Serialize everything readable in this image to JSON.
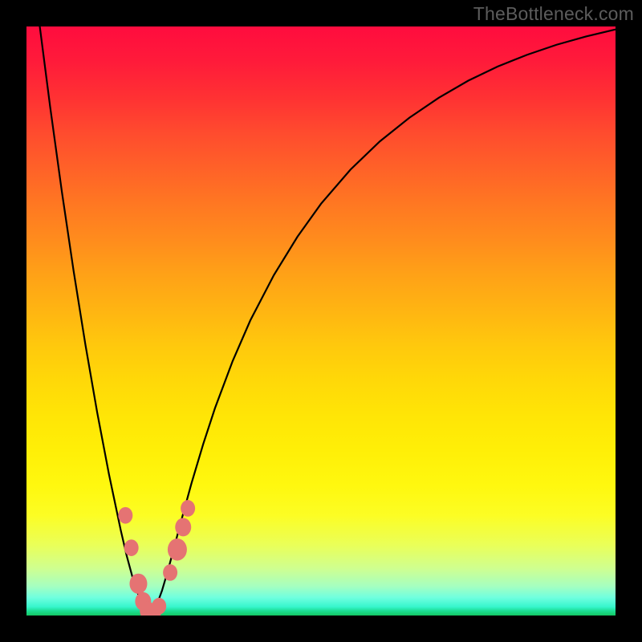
{
  "watermark": "TheBottleneck.com",
  "colors": {
    "curve": "#000000",
    "marker_fill": "#e57373",
    "marker_stroke": "#cc5a5a",
    "gradient_top": "#ff0c3e",
    "gradient_bottom": "#14c864",
    "frame": "#000000"
  },
  "chart_data": {
    "type": "line",
    "title": "",
    "xlabel": "",
    "ylabel": "",
    "xlim": [
      0,
      100
    ],
    "ylim": [
      0,
      100
    ],
    "grid": false,
    "annotations": [],
    "legend": null,
    "curve_minimum_x": 21,
    "series": [
      {
        "name": "bottleneck-curve",
        "x": [
          0,
          2,
          4,
          6,
          8,
          10,
          12,
          14,
          16,
          17,
          18,
          19,
          20,
          20.5,
          21,
          21.5,
          22,
          23,
          24,
          25,
          26,
          28,
          30,
          32,
          35,
          38,
          42,
          46,
          50,
          55,
          60,
          65,
          70,
          75,
          80,
          85,
          90,
          95,
          100
        ],
        "y": [
          120,
          102,
          86.5,
          72,
          58.5,
          46,
          34.5,
          24,
          14.5,
          10.2,
          6.5,
          3.5,
          1.4,
          0.4,
          0,
          0.4,
          1.5,
          4.2,
          7.6,
          11.3,
          15.1,
          22.4,
          29.1,
          35.2,
          43.2,
          50.1,
          57.8,
          64.3,
          69.9,
          75.7,
          80.5,
          84.5,
          87.9,
          90.8,
          93.2,
          95.2,
          96.9,
          98.3,
          99.5
        ]
      },
      {
        "name": "markers",
        "points": [
          {
            "x": 16.8,
            "y": 17.0,
            "r": 9
          },
          {
            "x": 17.8,
            "y": 11.5,
            "r": 9
          },
          {
            "x": 19.0,
            "y": 5.4,
            "r": 11
          },
          {
            "x": 19.8,
            "y": 2.4,
            "r": 10
          },
          {
            "x": 20.6,
            "y": 0.8,
            "r": 10
          },
          {
            "x": 21.6,
            "y": 0.4,
            "r": 9
          },
          {
            "x": 22.5,
            "y": 1.6,
            "r": 9
          },
          {
            "x": 24.4,
            "y": 7.3,
            "r": 9
          },
          {
            "x": 25.6,
            "y": 11.2,
            "r": 12
          },
          {
            "x": 26.6,
            "y": 15.0,
            "r": 10
          },
          {
            "x": 27.4,
            "y": 18.2,
            "r": 9
          }
        ]
      }
    ]
  }
}
